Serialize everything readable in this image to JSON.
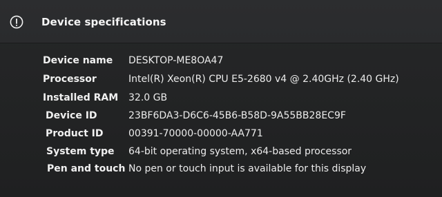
{
  "section": {
    "title": "Device specifications",
    "icon": "info-icon"
  },
  "specs": [
    {
      "label": "Device name",
      "value": "DESKTOP-ME8OA47"
    },
    {
      "label": "Processor",
      "value": "Intel(R) Xeon(R) CPU E5-2680 v4 @ 2.40GHz (2.40 GHz)"
    },
    {
      "label": "Installed RAM",
      "value": "32.0 GB"
    },
    {
      "label": "Device ID",
      "value": "23BF6DA3-D6C6-45B6-B58D-9A55BB28EC9F"
    },
    {
      "label": "Product ID",
      "value": "00391-70000-00000-AA771"
    },
    {
      "label": "System type",
      "value": "64-bit operating system, x64-based processor"
    },
    {
      "label": "Pen and touch",
      "value": "No pen or touch input is available for this display"
    }
  ]
}
